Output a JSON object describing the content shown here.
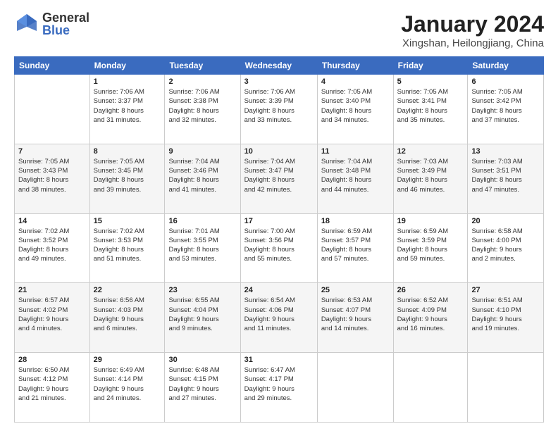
{
  "logo": {
    "general": "General",
    "blue": "Blue"
  },
  "title": "January 2024",
  "subtitle": "Xingshan, Heilongjiang, China",
  "weekdays": [
    "Sunday",
    "Monday",
    "Tuesday",
    "Wednesday",
    "Thursday",
    "Friday",
    "Saturday"
  ],
  "weeks": [
    [
      {
        "day": "",
        "info": ""
      },
      {
        "day": "1",
        "info": "Sunrise: 7:06 AM\nSunset: 3:37 PM\nDaylight: 8 hours\nand 31 minutes."
      },
      {
        "day": "2",
        "info": "Sunrise: 7:06 AM\nSunset: 3:38 PM\nDaylight: 8 hours\nand 32 minutes."
      },
      {
        "day": "3",
        "info": "Sunrise: 7:06 AM\nSunset: 3:39 PM\nDaylight: 8 hours\nand 33 minutes."
      },
      {
        "day": "4",
        "info": "Sunrise: 7:05 AM\nSunset: 3:40 PM\nDaylight: 8 hours\nand 34 minutes."
      },
      {
        "day": "5",
        "info": "Sunrise: 7:05 AM\nSunset: 3:41 PM\nDaylight: 8 hours\nand 35 minutes."
      },
      {
        "day": "6",
        "info": "Sunrise: 7:05 AM\nSunset: 3:42 PM\nDaylight: 8 hours\nand 37 minutes."
      }
    ],
    [
      {
        "day": "7",
        "info": "Sunrise: 7:05 AM\nSunset: 3:43 PM\nDaylight: 8 hours\nand 38 minutes."
      },
      {
        "day": "8",
        "info": "Sunrise: 7:05 AM\nSunset: 3:45 PM\nDaylight: 8 hours\nand 39 minutes."
      },
      {
        "day": "9",
        "info": "Sunrise: 7:04 AM\nSunset: 3:46 PM\nDaylight: 8 hours\nand 41 minutes."
      },
      {
        "day": "10",
        "info": "Sunrise: 7:04 AM\nSunset: 3:47 PM\nDaylight: 8 hours\nand 42 minutes."
      },
      {
        "day": "11",
        "info": "Sunrise: 7:04 AM\nSunset: 3:48 PM\nDaylight: 8 hours\nand 44 minutes."
      },
      {
        "day": "12",
        "info": "Sunrise: 7:03 AM\nSunset: 3:49 PM\nDaylight: 8 hours\nand 46 minutes."
      },
      {
        "day": "13",
        "info": "Sunrise: 7:03 AM\nSunset: 3:51 PM\nDaylight: 8 hours\nand 47 minutes."
      }
    ],
    [
      {
        "day": "14",
        "info": "Sunrise: 7:02 AM\nSunset: 3:52 PM\nDaylight: 8 hours\nand 49 minutes."
      },
      {
        "day": "15",
        "info": "Sunrise: 7:02 AM\nSunset: 3:53 PM\nDaylight: 8 hours\nand 51 minutes."
      },
      {
        "day": "16",
        "info": "Sunrise: 7:01 AM\nSunset: 3:55 PM\nDaylight: 8 hours\nand 53 minutes."
      },
      {
        "day": "17",
        "info": "Sunrise: 7:00 AM\nSunset: 3:56 PM\nDaylight: 8 hours\nand 55 minutes."
      },
      {
        "day": "18",
        "info": "Sunrise: 6:59 AM\nSunset: 3:57 PM\nDaylight: 8 hours\nand 57 minutes."
      },
      {
        "day": "19",
        "info": "Sunrise: 6:59 AM\nSunset: 3:59 PM\nDaylight: 8 hours\nand 59 minutes."
      },
      {
        "day": "20",
        "info": "Sunrise: 6:58 AM\nSunset: 4:00 PM\nDaylight: 9 hours\nand 2 minutes."
      }
    ],
    [
      {
        "day": "21",
        "info": "Sunrise: 6:57 AM\nSunset: 4:02 PM\nDaylight: 9 hours\nand 4 minutes."
      },
      {
        "day": "22",
        "info": "Sunrise: 6:56 AM\nSunset: 4:03 PM\nDaylight: 9 hours\nand 6 minutes."
      },
      {
        "day": "23",
        "info": "Sunrise: 6:55 AM\nSunset: 4:04 PM\nDaylight: 9 hours\nand 9 minutes."
      },
      {
        "day": "24",
        "info": "Sunrise: 6:54 AM\nSunset: 4:06 PM\nDaylight: 9 hours\nand 11 minutes."
      },
      {
        "day": "25",
        "info": "Sunrise: 6:53 AM\nSunset: 4:07 PM\nDaylight: 9 hours\nand 14 minutes."
      },
      {
        "day": "26",
        "info": "Sunrise: 6:52 AM\nSunset: 4:09 PM\nDaylight: 9 hours\nand 16 minutes."
      },
      {
        "day": "27",
        "info": "Sunrise: 6:51 AM\nSunset: 4:10 PM\nDaylight: 9 hours\nand 19 minutes."
      }
    ],
    [
      {
        "day": "28",
        "info": "Sunrise: 6:50 AM\nSunset: 4:12 PM\nDaylight: 9 hours\nand 21 minutes."
      },
      {
        "day": "29",
        "info": "Sunrise: 6:49 AM\nSunset: 4:14 PM\nDaylight: 9 hours\nand 24 minutes."
      },
      {
        "day": "30",
        "info": "Sunrise: 6:48 AM\nSunset: 4:15 PM\nDaylight: 9 hours\nand 27 minutes."
      },
      {
        "day": "31",
        "info": "Sunrise: 6:47 AM\nSunset: 4:17 PM\nDaylight: 9 hours\nand 29 minutes."
      },
      {
        "day": "",
        "info": ""
      },
      {
        "day": "",
        "info": ""
      },
      {
        "day": "",
        "info": ""
      }
    ]
  ]
}
